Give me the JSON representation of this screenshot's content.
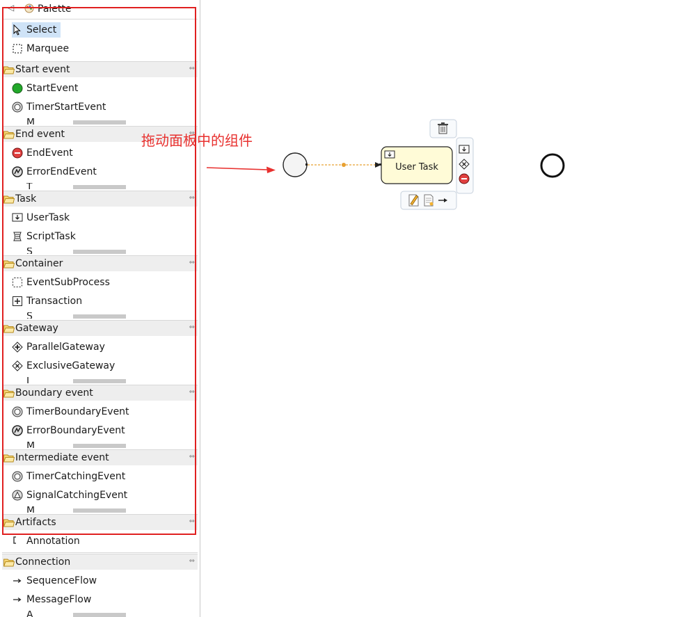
{
  "palette": {
    "title": "Palette",
    "tools": [
      {
        "label": "Select",
        "icon": "cursor-icon",
        "selected": true
      },
      {
        "label": "Marquee",
        "icon": "marquee-icon"
      }
    ],
    "drawers": [
      {
        "name": "Start event",
        "items": [
          "StartEvent",
          "TimerStartEvent"
        ],
        "partial": "M"
      },
      {
        "name": "End event",
        "items": [
          "EndEvent",
          "ErrorEndEvent"
        ],
        "partial": "T"
      },
      {
        "name": "Task",
        "items": [
          "UserTask",
          "ScriptTask"
        ],
        "partial": "S"
      },
      {
        "name": "Container",
        "items": [
          "EventSubProcess",
          "Transaction"
        ],
        "partial": "S"
      },
      {
        "name": "Gateway",
        "items": [
          "ParallelGateway",
          "ExclusiveGateway"
        ],
        "partial": "I"
      },
      {
        "name": "Boundary event",
        "items": [
          "TimerBoundaryEvent",
          "ErrorBoundaryEvent"
        ],
        "partial": "M"
      },
      {
        "name": "Intermediate event",
        "items": [
          "TimerCatchingEvent",
          "SignalCatchingEvent"
        ],
        "partial": "M"
      },
      {
        "name": "Artifacts",
        "items": [
          "Annotation"
        ]
      },
      {
        "name": "Connection",
        "items": [
          "SequenceFlow",
          "MessageFlow"
        ],
        "partial": "A"
      }
    ]
  },
  "annotation": {
    "text": "拖动面板中的组件",
    "color": "#e8312f"
  },
  "diagram": {
    "task_label": "User Task",
    "task_fill": "#fffbd7",
    "flow_color": "#e8a030"
  }
}
